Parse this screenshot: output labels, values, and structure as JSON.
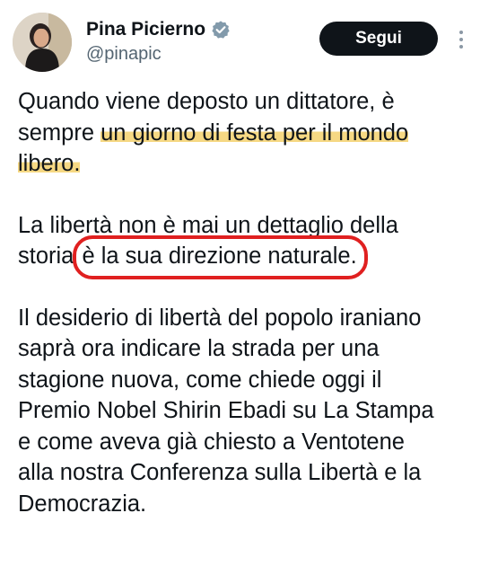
{
  "author": {
    "display_name": "Pina Picierno",
    "handle": "@pinapic",
    "verified": true
  },
  "actions": {
    "follow_label": "Segui"
  },
  "tweet": {
    "p1_l1": "Quando viene deposto un dittatore, è",
    "p1_l2_plain": "sempre ",
    "p1_l2_hl": "un giorno di festa per il mondo",
    "p1_l3_hl": "libero.",
    "p2_l1": "La libertà non è mai un dettaglio della",
    "p2_l2_plain": "storia ",
    "p2_l2_circled": "è la sua direzione naturale.",
    "p3_lines": [
      "Il desiderio di libertà del popolo iraniano",
      "saprà ora indicare la strada per una",
      "stagione nuova, come chiede oggi il",
      "Premio Nobel Shirin Ebadi su La Stampa",
      "e come aveva già chiesto a Ventotene",
      "alla nostra Conferenza sulla Libertà e la",
      "Democrazia."
    ]
  },
  "annotations": {
    "highlight_color": "#f4cd60",
    "circle_color": "#e02020"
  },
  "icons": {
    "verified": "verified-badge-icon",
    "more": "more-vertical-icon"
  }
}
